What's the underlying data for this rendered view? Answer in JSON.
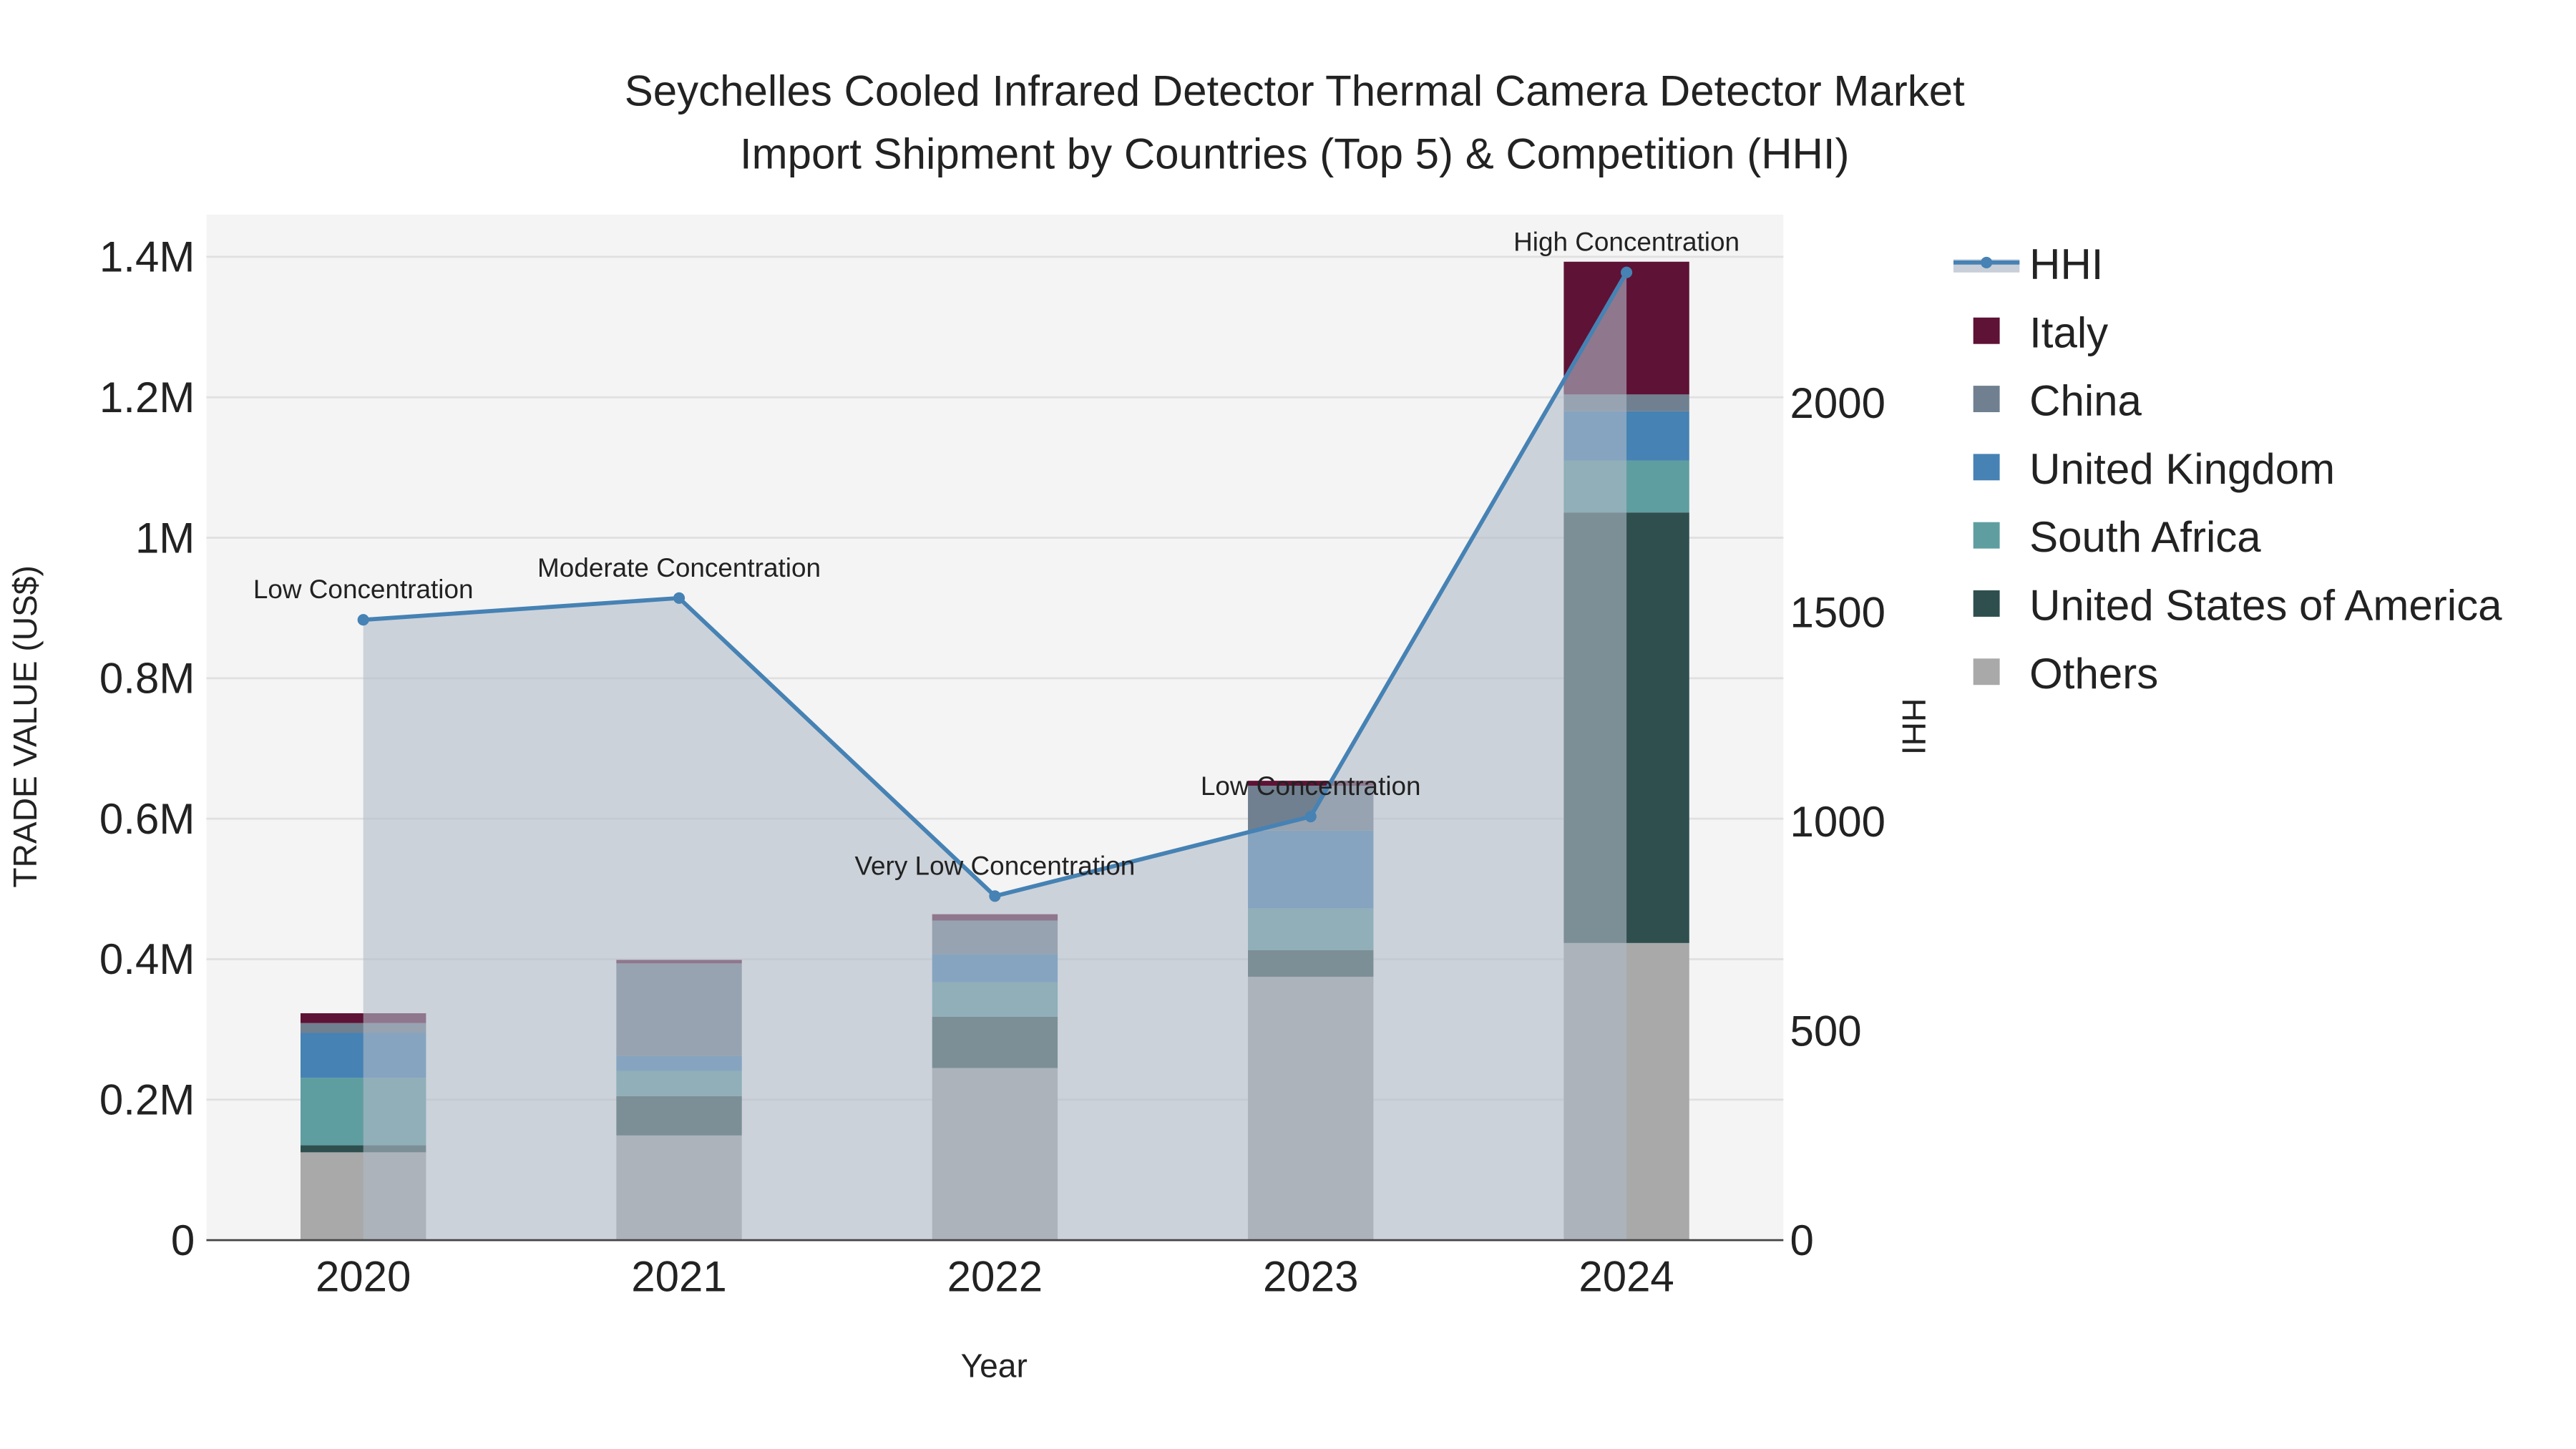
{
  "chart_data": {
    "type": "bar",
    "stacked": true,
    "title_line1": "Seychelles Cooled Infrared Detector Thermal Camera Detector Market",
    "title_line2": "Import Shipment by Countries (Top 5) & Competition (HHI)",
    "xlabel": "Year",
    "ylabel": "TRADE VALUE (US$)",
    "y2label": "HHI",
    "categories": [
      "2020",
      "2021",
      "2022",
      "2023",
      "2024"
    ],
    "ylim": [
      0,
      1460000
    ],
    "y2lim": [
      0,
      2450
    ],
    "yticks": [
      {
        "v": 0,
        "label": "0"
      },
      {
        "v": 200000,
        "label": "0.2M"
      },
      {
        "v": 400000,
        "label": "0.4M"
      },
      {
        "v": 600000,
        "label": "0.6M"
      },
      {
        "v": 800000,
        "label": "0.8M"
      },
      {
        "v": 1000000,
        "label": "1M"
      },
      {
        "v": 1200000,
        "label": "1.2M"
      },
      {
        "v": 1400000,
        "label": "1.4M"
      }
    ],
    "y2ticks": [
      {
        "v": 0,
        "label": "0"
      },
      {
        "v": 500,
        "label": "500"
      },
      {
        "v": 1000,
        "label": "1000"
      },
      {
        "v": 1500,
        "label": "1500"
      },
      {
        "v": 2000,
        "label": "2000"
      }
    ],
    "grid": true,
    "legend_position": "right",
    "series": [
      {
        "name": "Others",
        "color": "#a9a9a9",
        "values": [
          125000,
          149000,
          245000,
          375000,
          423000
        ]
      },
      {
        "name": "United States of America",
        "color": "#2f4f4f",
        "values": [
          10000,
          56000,
          73000,
          38000,
          613000
        ]
      },
      {
        "name": "South Africa",
        "color": "#5f9ea0",
        "values": [
          96000,
          36000,
          49000,
          59000,
          74000
        ]
      },
      {
        "name": "United Kingdom",
        "color": "#4682b4",
        "values": [
          64000,
          21000,
          40000,
          111000,
          70000
        ]
      },
      {
        "name": "China",
        "color": "#708090",
        "values": [
          14000,
          132000,
          48000,
          64000,
          24000
        ]
      },
      {
        "name": "Italy",
        "color": "#5e1235",
        "values": [
          14000,
          5000,
          9000,
          7000,
          189000
        ]
      }
    ],
    "hhi": {
      "name": "HHI",
      "color": "#4682b4",
      "values": [
        1482,
        1534,
        822,
        1012,
        2312
      ],
      "annotations": [
        "Low Concentration",
        "Moderate Concentration",
        "Very Low Concentration",
        "Low Concentration",
        "High Concentration"
      ]
    },
    "legend_order": [
      "HHI",
      "Italy",
      "China",
      "United Kingdom",
      "South Africa",
      "United States of America",
      "Others"
    ]
  }
}
